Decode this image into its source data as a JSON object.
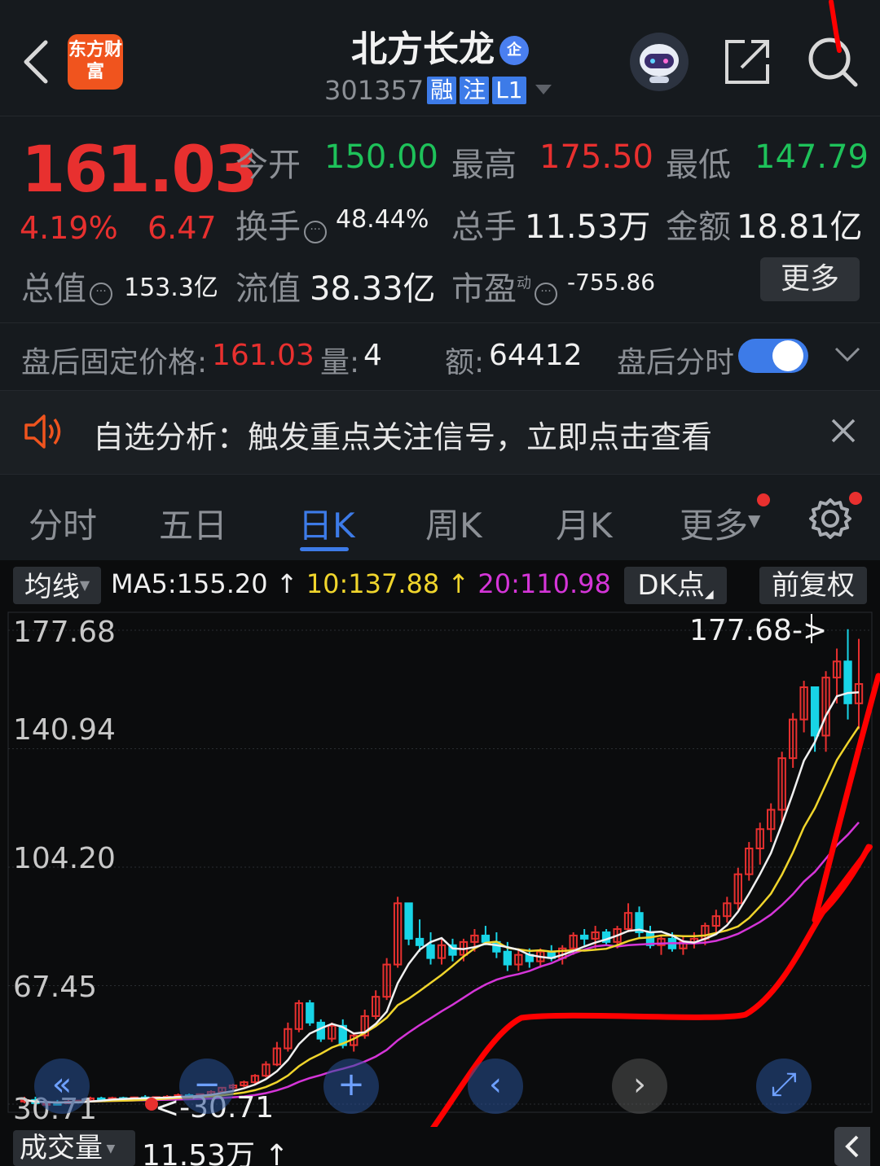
{
  "header": {
    "logo_text": "东方财富",
    "title": "北方长龙",
    "title_badge": "企",
    "code": "301357",
    "tags": [
      "融",
      "注",
      "L1"
    ]
  },
  "quote": {
    "price": "161.03",
    "change_pct": "4.19%",
    "change": "6.47",
    "open_label": "今开",
    "open": "150.00",
    "high_label": "最高",
    "high": "175.50",
    "low_label": "最低",
    "low": "147.79",
    "turnover_label": "换手",
    "turnover": "48.44%",
    "volume_label": "总手",
    "volume": "11.53万",
    "amount_label": "金额",
    "amount": "18.81亿",
    "mktcap_label": "总值",
    "mktcap": "153.3亿",
    "float_label": "流值",
    "float_cap": "38.33亿",
    "pe_label": "市盈",
    "pe_sup": "动",
    "pe": "-755.86",
    "more_label": "更多"
  },
  "after_hours": {
    "price_label": "盘后固定价格:",
    "price": "161.03",
    "vol_label": "量:",
    "vol": "4",
    "amt_label": "额:",
    "amt": "64412",
    "toggle_label": "盘后分时",
    "toggle_on": true
  },
  "notice": {
    "text": "自选分析：触发重点关注信号，立即点击查看"
  },
  "tabs": [
    "分时",
    "五日",
    "日K",
    "周K",
    "月K",
    "更多"
  ],
  "active_tab": "日K",
  "chart_bar": {
    "ma_selector": "均线",
    "ma5": "MA5:155.20",
    "ma10": "10:137.88",
    "ma20": "20:110.98",
    "dk_label": "DK点",
    "adjust_label": "前复权"
  },
  "chart_data": {
    "type": "candlestick",
    "y_ticks": [
      "177.68",
      "140.94",
      "104.20",
      "67.45",
      "30.71"
    ],
    "ylim": [
      30.71,
      177.68
    ],
    "max_label": "177.68->",
    "min_label": "<-30.71",
    "candles": [
      [
        32,
        33,
        31,
        32
      ],
      [
        32,
        33,
        31,
        31
      ],
      [
        31,
        32,
        30,
        31
      ],
      [
        31,
        32,
        30.7,
        30.9
      ],
      [
        31,
        32,
        30.7,
        31.5
      ],
      [
        31.5,
        32,
        31,
        31.8
      ],
      [
        31.8,
        33,
        31.5,
        32.5
      ],
      [
        32.5,
        33,
        32,
        32.2
      ],
      [
        32.2,
        33,
        31.8,
        32.6
      ],
      [
        32.6,
        33,
        32,
        32.3
      ],
      [
        32.3,
        33,
        32,
        32.8
      ],
      [
        32.8,
        33.5,
        32.3,
        32.6
      ],
      [
        32.6,
        33,
        32,
        32.9
      ],
      [
        32.9,
        33.5,
        32.4,
        33
      ],
      [
        33,
        34,
        32.6,
        33.5
      ],
      [
        33.5,
        34,
        33,
        33.2
      ],
      [
        33.2,
        34,
        32.8,
        33.8
      ],
      [
        33.8,
        35,
        33.4,
        34.5
      ],
      [
        34.5,
        36,
        34,
        35.8
      ],
      [
        35.8,
        37,
        35,
        36.5
      ],
      [
        36.5,
        38,
        36,
        37.5
      ],
      [
        37.5,
        40,
        37,
        39.5
      ],
      [
        39.5,
        44,
        39,
        43
      ],
      [
        43,
        50,
        42.5,
        48
      ],
      [
        48,
        56,
        47,
        54
      ],
      [
        54,
        63,
        53,
        62
      ],
      [
        62,
        63,
        55,
        56
      ],
      [
        56,
        57,
        50,
        51
      ],
      [
        51,
        56,
        50,
        55
      ],
      [
        55,
        57,
        48,
        49
      ],
      [
        49,
        53,
        47,
        52
      ],
      [
        52,
        60,
        51,
        58
      ],
      [
        58,
        66,
        57,
        64
      ],
      [
        64,
        76,
        63,
        74
      ],
      [
        74,
        95,
        73,
        93
      ],
      [
        93,
        90,
        80,
        82
      ],
      [
        82,
        88,
        78,
        80
      ],
      [
        80,
        84,
        74,
        76
      ],
      [
        76,
        82,
        74,
        80
      ],
      [
        80,
        82,
        75,
        77
      ],
      [
        77,
        82,
        75,
        81
      ],
      [
        81,
        85,
        78,
        83
      ],
      [
        83,
        86,
        80,
        81
      ],
      [
        81,
        84,
        76,
        78
      ],
      [
        78,
        81,
        72,
        74
      ],
      [
        74,
        79,
        72,
        77
      ],
      [
        77,
        79,
        73,
        75
      ],
      [
        75,
        79,
        73,
        78
      ],
      [
        78,
        80,
        75,
        76
      ],
      [
        76,
        80,
        74,
        79
      ],
      [
        79,
        84,
        77,
        83
      ],
      [
        83,
        85,
        80,
        82
      ],
      [
        82,
        86,
        79,
        84
      ],
      [
        84,
        85,
        80,
        81
      ],
      [
        81,
        86,
        79,
        85
      ],
      [
        85,
        93,
        84,
        90
      ],
      [
        90,
        92,
        82,
        84
      ],
      [
        84,
        86,
        79,
        80
      ],
      [
        80,
        83,
        77,
        82
      ],
      [
        82,
        84,
        78,
        79
      ],
      [
        79,
        83,
        77,
        81
      ],
      [
        81,
        84,
        79,
        82
      ],
      [
        82,
        87,
        80,
        86
      ],
      [
        86,
        91,
        84,
        89
      ],
      [
        89,
        95,
        87,
        93
      ],
      [
        93,
        104,
        91,
        102
      ],
      [
        102,
        112,
        100,
        110
      ],
      [
        110,
        118,
        105,
        116
      ],
      [
        116,
        124,
        112,
        122
      ],
      [
        122,
        140,
        118,
        138
      ],
      [
        138,
        152,
        135,
        150
      ],
      [
        150,
        162,
        146,
        160
      ],
      [
        160,
        158,
        140,
        145
      ],
      [
        145,
        165,
        140,
        163
      ],
      [
        163,
        172,
        155,
        168
      ],
      [
        168,
        178,
        150,
        155
      ],
      [
        155,
        175,
        147,
        161
      ]
    ],
    "ma5_label": "MA5",
    "ma10_label": "MA10",
    "ma20_label": "MA20"
  },
  "volume_bar": {
    "selector": "成交量",
    "value": "11.53万"
  },
  "colors": {
    "up": "#e8302f",
    "down": "#18d4e6",
    "ma5": "#f0f0f0",
    "ma10": "#f0d52c",
    "ma20": "#d535d8",
    "accent": "#3d7be8",
    "annotation": "#ff0000"
  }
}
